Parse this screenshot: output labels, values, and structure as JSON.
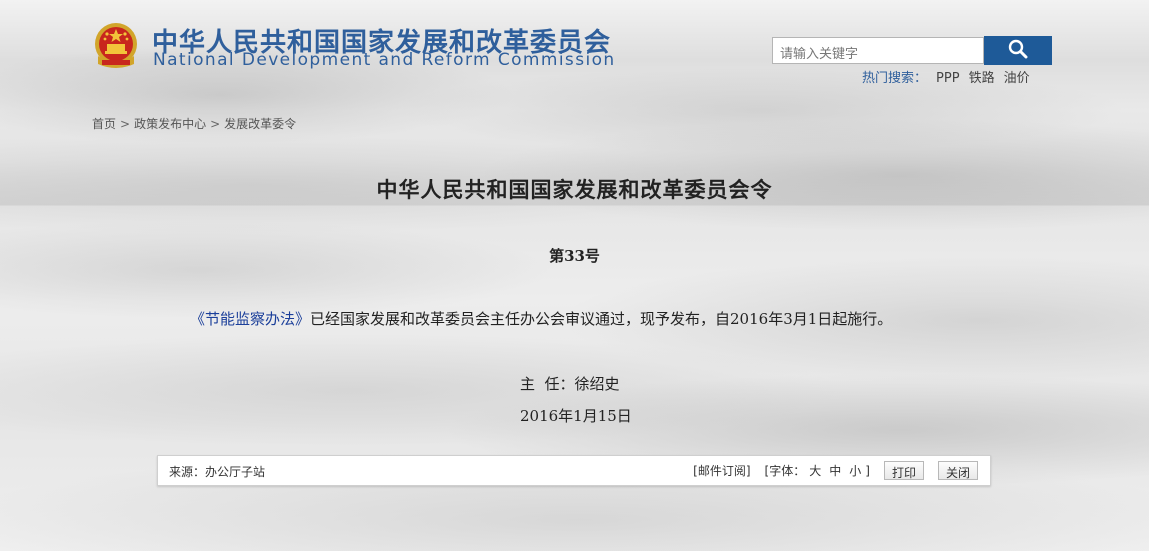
{
  "header": {
    "title_cn": "中华人民共和国国家发展和改革委员会",
    "title_en": "National Development and Reform Commission",
    "emblem_icon": "national-emblem-icon"
  },
  "search": {
    "placeholder": "请输入关键字",
    "button_icon": "search-icon",
    "hot_label": "热门搜索",
    "hot_colon": "：",
    "hot_keywords": [
      "PPP",
      "铁路",
      "油价"
    ]
  },
  "breadcrumb": {
    "items": [
      "首页",
      "政策发布中心",
      "发展改革委令"
    ],
    "separator": ">"
  },
  "article": {
    "title": "中华人民共和国国家发展和改革委员会令",
    "order_no": "第33号",
    "doc_link": "《节能监察办法》",
    "body": "已经国家发展和改革委员会主任办公会审议通过，现予发布，自2016年3月1日起施行。",
    "signer": "主  任：徐绍史",
    "date": "2016年1月15日"
  },
  "footer": {
    "source": "来源：办公厅子站",
    "subscribe": "[邮件订阅]",
    "font_open": "[字体：",
    "font_sizes": [
      "大",
      "中",
      "小"
    ],
    "font_close": "]",
    "print": "打印",
    "close": "关闭"
  },
  "colors": {
    "brand_blue": "#2f5f9c",
    "search_button": "#1e5a98",
    "link_blue": "#1b3f9a"
  }
}
